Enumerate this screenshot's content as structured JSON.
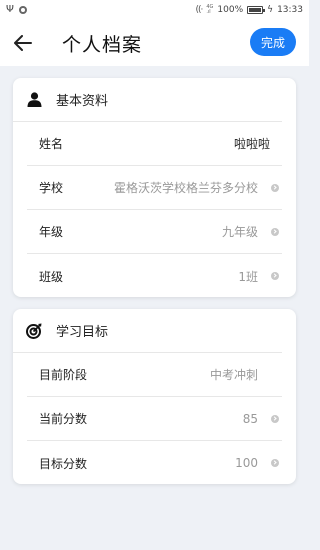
{
  "status_bar": {
    "battery_percent": "100%",
    "time": "13:33",
    "network": "4G"
  },
  "header": {
    "title": "个人档案",
    "done_label": "完成"
  },
  "basic_info": {
    "title": "基本资料",
    "rows": [
      {
        "label": "姓名",
        "value": "啦啦啦"
      },
      {
        "label": "学校",
        "value": "霍格沃茨学校格兰芬多分校"
      },
      {
        "label": "年级",
        "value": "九年级"
      },
      {
        "label": "班级",
        "value": "1班"
      }
    ]
  },
  "study_goal": {
    "title": "学习目标",
    "rows": [
      {
        "label": "目前阶段",
        "value": "中考冲刺"
      },
      {
        "label": "当前分数",
        "value": "85"
      },
      {
        "label": "目标分数",
        "value": "100"
      }
    ]
  },
  "colors": {
    "accent": "#1a7cf5",
    "background": "#eef1f6"
  }
}
